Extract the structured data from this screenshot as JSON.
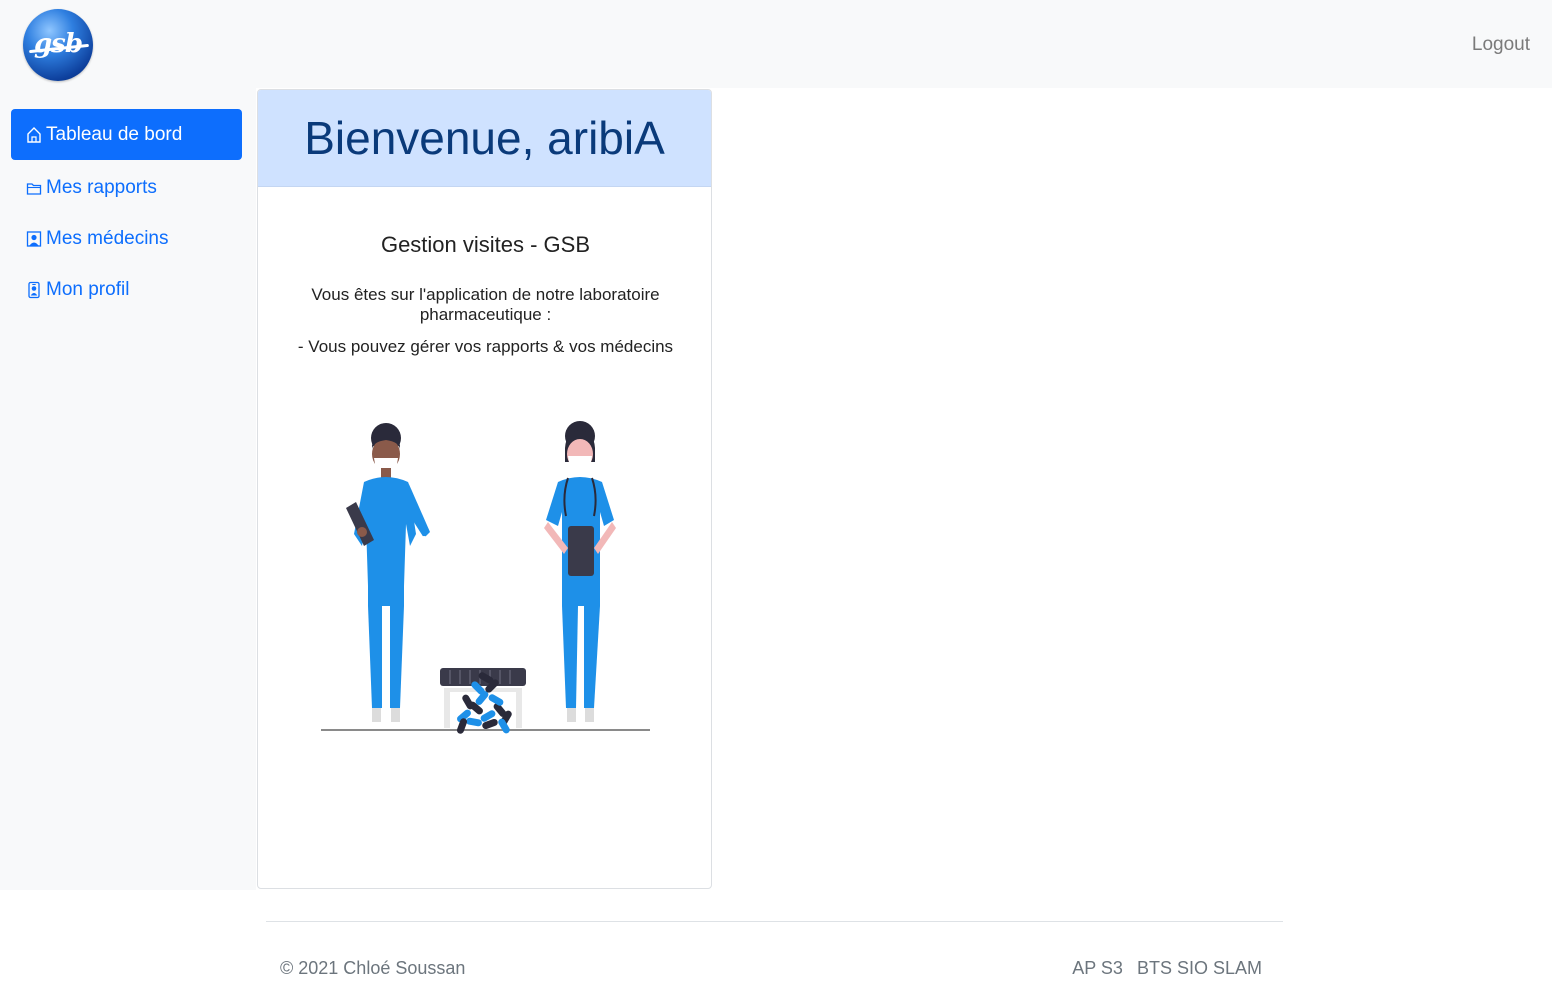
{
  "navbar": {
    "logo_text": "gsb",
    "logout_label": "Logout"
  },
  "sidebar": {
    "items": [
      {
        "label": "Tableau de bord",
        "icon": "house-icon",
        "active": true
      },
      {
        "label": "Mes rapports",
        "icon": "folder-icon",
        "active": false
      },
      {
        "label": "Mes médecins",
        "icon": "person-square-icon",
        "active": false
      },
      {
        "label": "Mon profil",
        "icon": "person-badge-icon",
        "active": false
      }
    ]
  },
  "card": {
    "title": "Bienvenue, aribiA",
    "subtitle": "Gestion visites - GSB",
    "intro": "Vous êtes sur l'application de notre laboratoire pharmaceutique :",
    "bullet": "- Vous pouvez gérer vos rapports & vos médecins",
    "illustration_icon": "nurses-with-pill-jar-illustration"
  },
  "footer": {
    "copyright": "© 2021 Chloé Soussan",
    "links": [
      "AP S3",
      "BTS SIO SLAM"
    ]
  },
  "colors": {
    "primary": "#0d6efd",
    "header_bg": "#cfe2ff",
    "title_text": "#0a3a7a",
    "sidebar_bg": "#f8f9fa",
    "scrubs": "#1e90e8"
  }
}
